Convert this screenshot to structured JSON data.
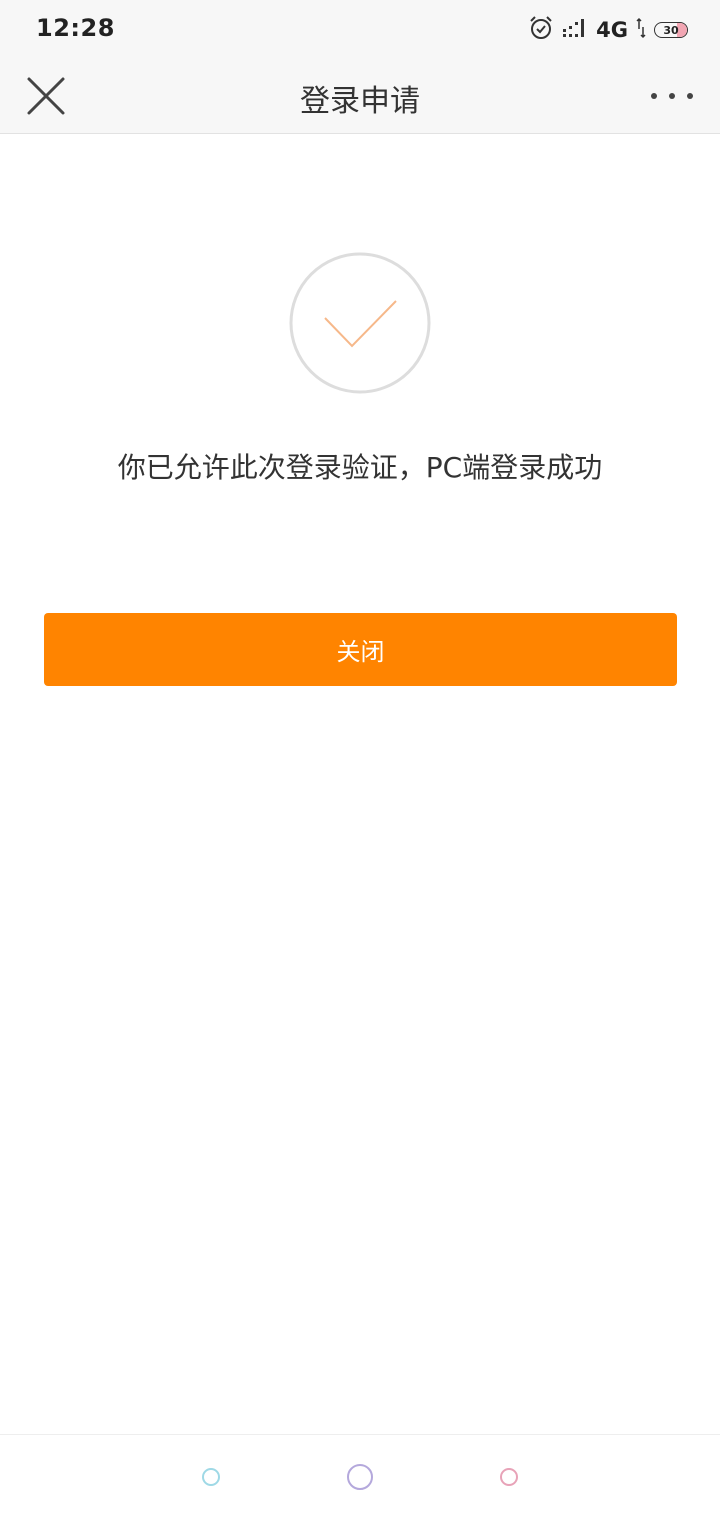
{
  "status_bar": {
    "time": "12:28",
    "network": "4G",
    "battery_level": "30",
    "icons": [
      "alarm-icon",
      "signal-icon",
      "data-transfer-icon",
      "battery-icon"
    ]
  },
  "nav": {
    "title": "登录申请",
    "close_icon": "close-icon",
    "more_icon": "more-icon"
  },
  "content": {
    "success_icon": "checkmark-icon",
    "message": "你已允许此次登录验证，PC端登录成功",
    "close_button_label": "关闭"
  },
  "bottom_nav": {
    "items": [
      "back-circle-icon",
      "home-circle-icon",
      "recent-circle-icon"
    ]
  },
  "colors": {
    "accent": "#ff8400",
    "checkmark": "#f6b88a",
    "circle_border": "#dddddd",
    "text_primary": "#333333",
    "bar_background": "#f7f7f7"
  }
}
